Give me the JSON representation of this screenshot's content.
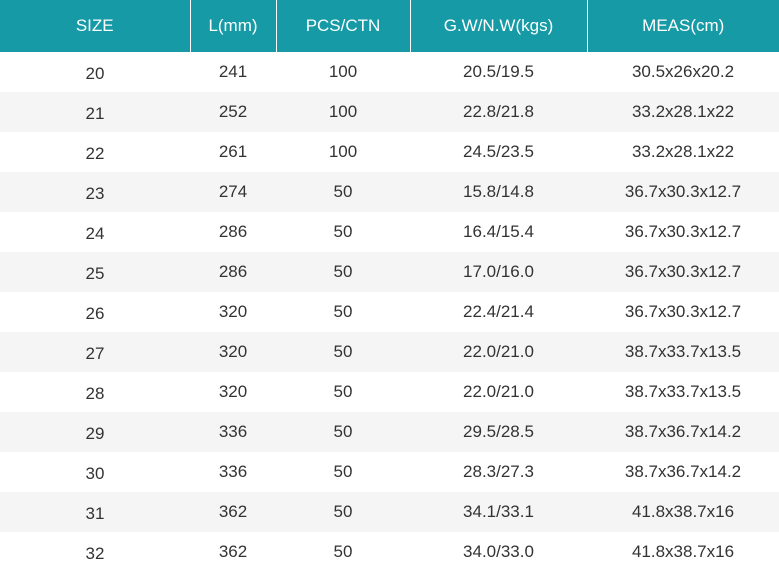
{
  "colors": {
    "header_bg": "#169aa6",
    "header_text": "#ffffff",
    "row_alt_bg": "#f5f5f5",
    "cell_text": "#333333"
  },
  "table": {
    "headers": [
      "SIZE",
      "L(mm)",
      "PCS/CTN",
      "G.W/N.W(kgs)",
      "MEAS(cm)"
    ],
    "rows": [
      [
        "20",
        "241",
        "100",
        "20.5/19.5",
        "30.5x26x20.2"
      ],
      [
        "21",
        "252",
        "100",
        "22.8/21.8",
        "33.2x28.1x22"
      ],
      [
        "22",
        "261",
        "100",
        "24.5/23.5",
        "33.2x28.1x22"
      ],
      [
        "23",
        "274",
        "50",
        "15.8/14.8",
        "36.7x30.3x12.7"
      ],
      [
        "24",
        "286",
        "50",
        "16.4/15.4",
        "36.7x30.3x12.7"
      ],
      [
        "25",
        "286",
        "50",
        "17.0/16.0",
        "36.7x30.3x12.7"
      ],
      [
        "26",
        "320",
        "50",
        "22.4/21.4",
        "36.7x30.3x12.7"
      ],
      [
        "27",
        "320",
        "50",
        "22.0/21.0",
        "38.7x33.7x13.5"
      ],
      [
        "28",
        "320",
        "50",
        "22.0/21.0",
        "38.7x33.7x13.5"
      ],
      [
        "29",
        "336",
        "50",
        "29.5/28.5",
        "38.7x36.7x14.2"
      ],
      [
        "30",
        "336",
        "50",
        "28.3/27.3",
        "38.7x36.7x14.2"
      ],
      [
        "31",
        "362",
        "50",
        "34.1/33.1",
        "41.8x38.7x16"
      ],
      [
        "32",
        "362",
        "50",
        "34.0/33.0",
        "41.8x38.7x16"
      ]
    ]
  }
}
